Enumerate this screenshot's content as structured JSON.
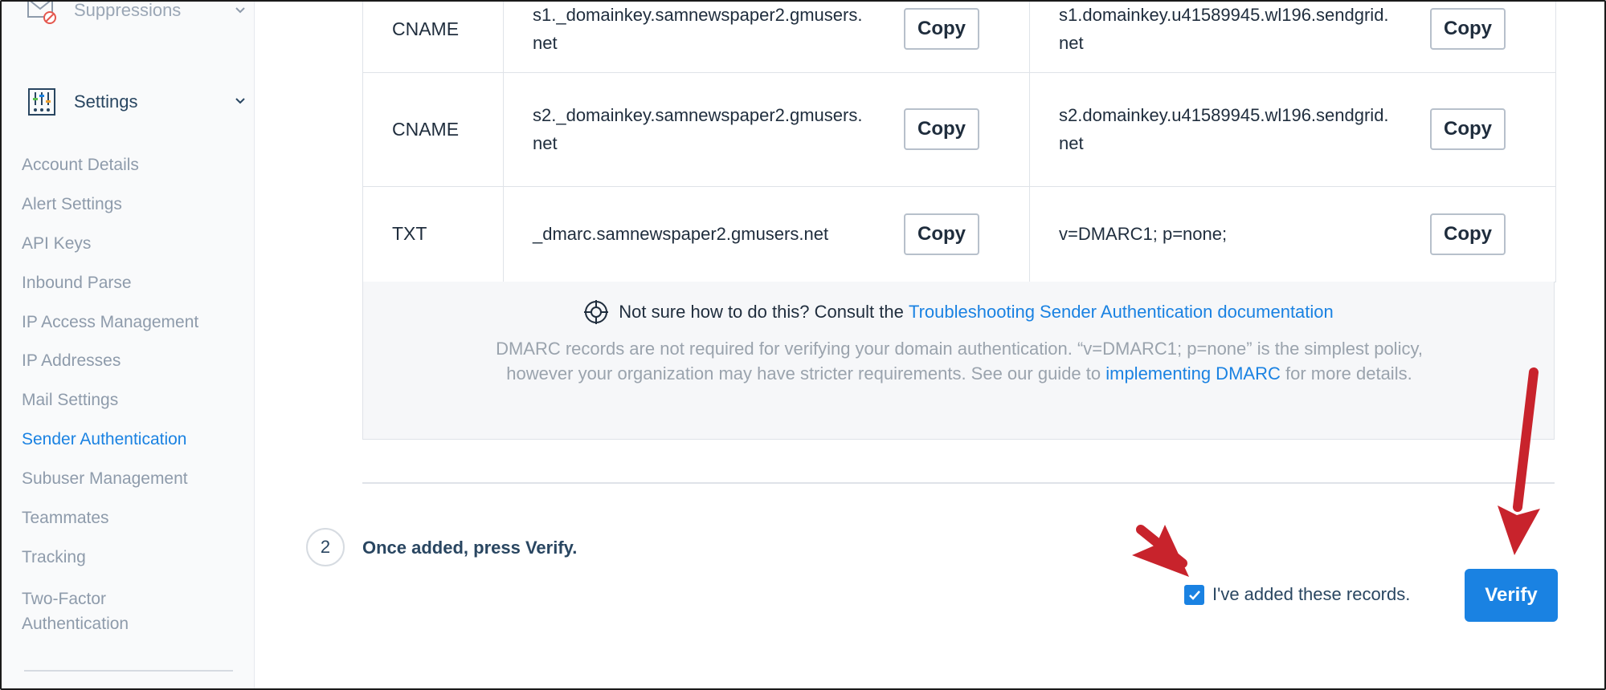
{
  "sidebar": {
    "sections": {
      "suppressions": "Suppressions",
      "settings": "Settings"
    },
    "items": [
      {
        "label": "Account Details"
      },
      {
        "label": "Alert Settings"
      },
      {
        "label": "API Keys"
      },
      {
        "label": "Inbound Parse"
      },
      {
        "label": "IP Access Management"
      },
      {
        "label": "IP Addresses"
      },
      {
        "label": "Mail Settings"
      },
      {
        "label": "Sender Authentication",
        "active": true
      },
      {
        "label": "Subuser Management"
      },
      {
        "label": "Teammates"
      },
      {
        "label": "Tracking"
      },
      {
        "label": "Two-Factor\nAuthentication"
      }
    ]
  },
  "records": [
    {
      "type": "CNAME",
      "host": "s1._domainkey.samnewspaper2.gmusers.net",
      "value": "s1.domainkey.u41589945.wl196.sendgrid.net",
      "copy": "Copy"
    },
    {
      "type": "CNAME",
      "host": "s2._domainkey.samnewspaper2.gmusers.net",
      "value": "s2.domainkey.u41589945.wl196.sendgrid.net",
      "copy": "Copy"
    },
    {
      "type": "TXT",
      "host": "_dmarc.samnewspaper2.gmusers.net",
      "value": "v=DMARC1; p=none;",
      "copy": "Copy"
    }
  ],
  "note": {
    "prefix": "Not sure how to do this? Consult the ",
    "link": "Troubleshooting Sender Authentication documentation",
    "body_before": "DMARC records are not required for verifying your domain authentication. “v=DMARC1; p=none” is the simplest policy, however your organization may have stricter requirements. See our guide to ",
    "body_link": "implementing DMARC",
    "body_after": " for more details."
  },
  "step": {
    "number": "2",
    "text": "Once added, press Verify."
  },
  "confirm": {
    "label": "I've added these records.",
    "checked": true
  },
  "verify_button": "Verify",
  "colors": {
    "accent": "#1a82e2",
    "arrow": "#c8232c"
  }
}
